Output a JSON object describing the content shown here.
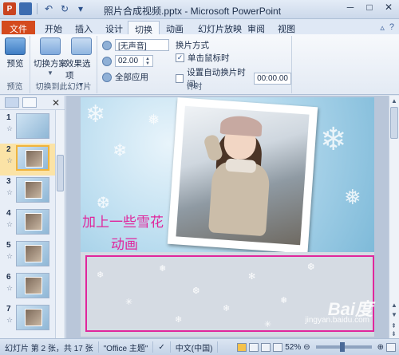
{
  "titlebar": {
    "app_icon": "P",
    "title": "照片合成视频.pptx - Microsoft PowerPoint",
    "controls": [
      "─",
      "□",
      "✕"
    ]
  },
  "tabs": [
    "文件",
    "开始",
    "插入",
    "设计",
    "切换",
    "动画",
    "幻灯片放映",
    "审阅",
    "视图"
  ],
  "ribbon": {
    "preview_group": {
      "label": "预览",
      "button": "预览"
    },
    "transition_group": {
      "label": "切换到此幻灯片",
      "scheme": "切换方案",
      "effect": "效果选项"
    },
    "timing_group": {
      "label": "计时",
      "sound": "[无声音]",
      "duration": "02.00",
      "apply_all": "全部应用",
      "switch_mode_title": "换片方式",
      "on_click": "单击鼠标时",
      "auto_after": "设置自动换片时间:",
      "auto_time": "00:00.00"
    }
  },
  "slides": [
    {
      "num": "1",
      "star": "☆"
    },
    {
      "num": "2",
      "star": "☆"
    },
    {
      "num": "3",
      "star": "☆"
    },
    {
      "num": "4",
      "star": "☆"
    },
    {
      "num": "5",
      "star": "☆"
    },
    {
      "num": "6",
      "star": "☆"
    },
    {
      "num": "7",
      "star": "☆"
    }
  ],
  "selected_slide": 2,
  "slide": {
    "caption_line1": "加上一些雪花",
    "caption_line2": "动画"
  },
  "watermark": {
    "main": "Bai度",
    "sub": "jingyan.baidu.com"
  },
  "statusbar": {
    "slide_info": "幻灯片 第 2 张，共 17 张",
    "theme": "\"Office 主题\"",
    "language": "中文(中国)",
    "zoom": "52%"
  },
  "colors": {
    "accent_file_tab": "#d44a1d",
    "highlight_box": "#e0269c",
    "caption": "#e0269c"
  }
}
